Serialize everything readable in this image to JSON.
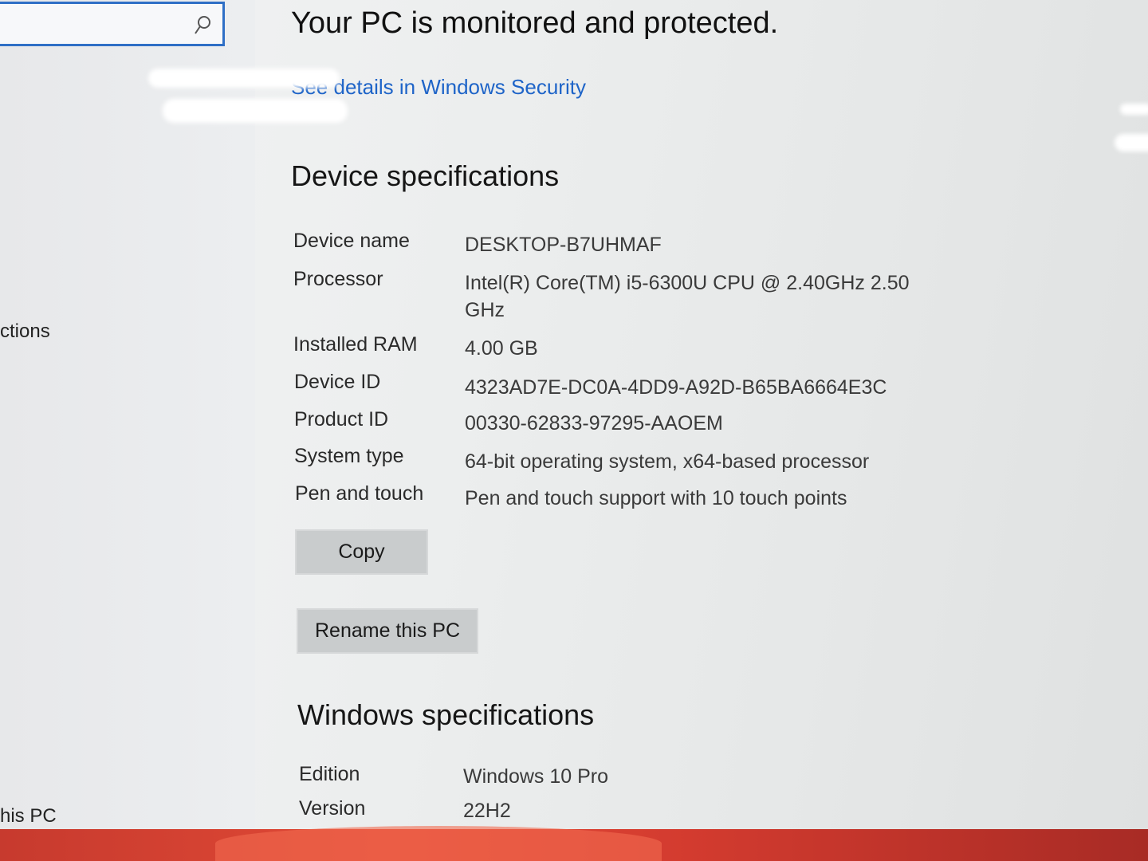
{
  "search": {
    "placeholder": "",
    "icon": "search-icon"
  },
  "sidebar": {
    "items": [
      {
        "label": "ctions"
      },
      {
        "label": "his PC"
      }
    ]
  },
  "security": {
    "title": "Your PC is monitored and protected.",
    "link_label": "See details in Windows Security"
  },
  "device_specs": {
    "title": "Device specifications",
    "rows": [
      {
        "label": "Device name",
        "value": "DESKTOP-B7UHMAF"
      },
      {
        "label": "Processor",
        "value": "Intel(R) Core(TM) i5-6300U CPU @ 2.40GHz   2.50 GHz"
      },
      {
        "label": "Installed RAM",
        "value": "4.00 GB"
      },
      {
        "label": "Device ID",
        "value": "4323AD7E-DC0A-4DD9-A92D-B65BA6664E3C"
      },
      {
        "label": "Product ID",
        "value": "00330-62833-97295-AAOEM"
      },
      {
        "label": "System type",
        "value": "64-bit operating system, x64-based processor"
      },
      {
        "label": "Pen and touch",
        "value": "Pen and touch support with 10 touch points"
      }
    ],
    "copy_label": "Copy",
    "rename_label": "Rename this PC"
  },
  "windows_specs": {
    "title": "Windows specifications",
    "rows": [
      {
        "label": "Edition",
        "value": "Windows 10 Pro"
      },
      {
        "label": "Version",
        "value": "22H2"
      }
    ]
  },
  "colors": {
    "accent": "#2f6fc6",
    "link": "#1e64c8",
    "button": "#c9cccd"
  }
}
